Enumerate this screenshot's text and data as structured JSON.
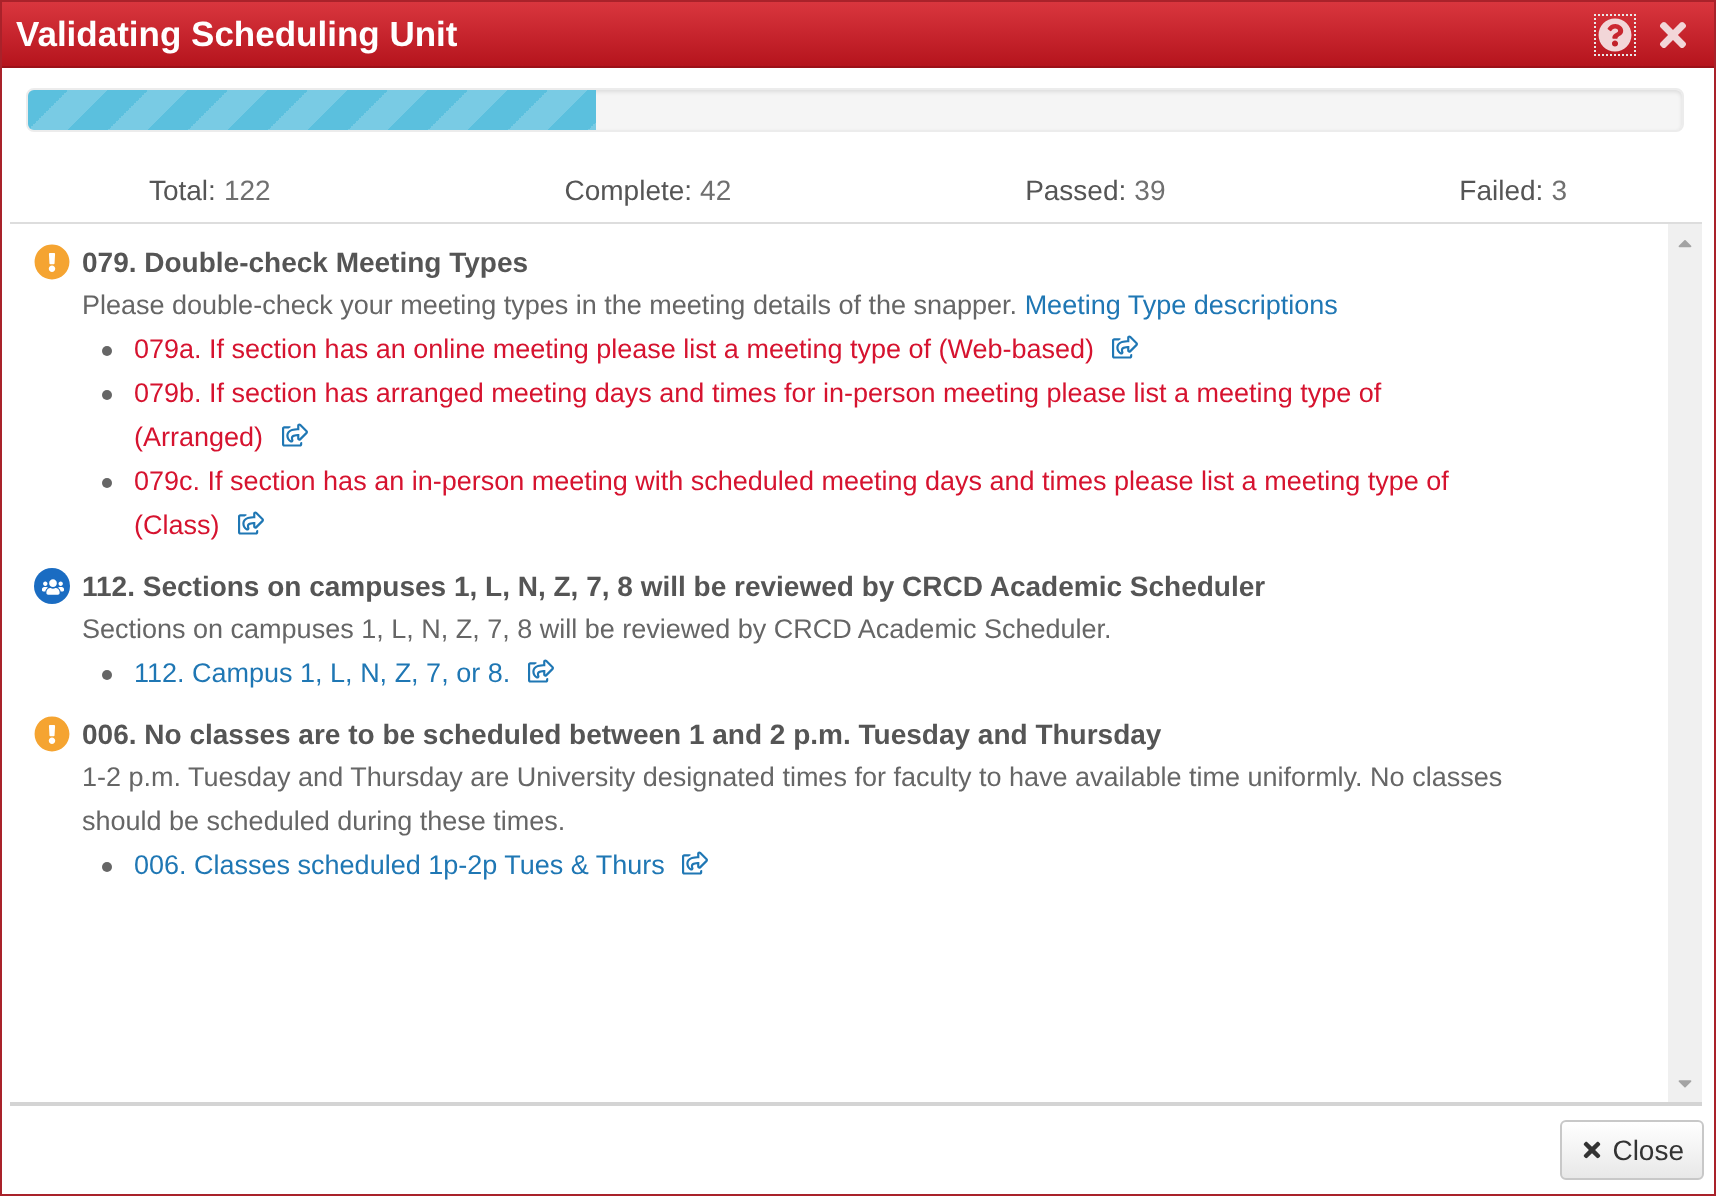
{
  "dialog": {
    "title": "Validating Scheduling Unit"
  },
  "progress": {
    "level": 0.344
  },
  "stats": [
    {
      "label": "Total:",
      "value": "122"
    },
    {
      "label": "Complete:",
      "value": "42"
    },
    {
      "label": "Passed:",
      "value": "39"
    },
    {
      "label": "Failed:",
      "value": "3"
    }
  ],
  "rules": [
    {
      "kind": "warning",
      "title": "079. Double-check Meeting Types",
      "description": "Please double-check your meeting types in the meeting details of the snapper.",
      "link": "Meeting Type descriptions",
      "items": [
        {
          "text": "079a. If section has an online meeting please list a meeting type of (Web-based)",
          "failed": true
        },
        {
          "text": "079b. If section has arranged meeting days and times for in-person meeting please list a meeting type of (Arranged)",
          "failed": true
        },
        {
          "text": "079c. If section has an in-person meeting with scheduled meeting days and times please list a meeting type of (Class)",
          "failed": true
        }
      ]
    },
    {
      "kind": "review",
      "title": "112. Sections on campuses 1, L, N, Z, 7, 8 will be reviewed by CRCD Academic Scheduler",
      "description": "Sections on campuses 1, L, N, Z, 7, 8 will be reviewed by CRCD Academic Scheduler.",
      "items": [
        {
          "text": "112. Campus 1, L, N, Z, 7, or 8.",
          "failed": false
        }
      ]
    },
    {
      "kind": "warning",
      "title": "006. No classes are to be scheduled between 1 and 2 p.m. Tuesday and Thursday",
      "description": "1-2 p.m. Tuesday and Thursday are University designated times for faculty to have available time uniformly. No classes should be scheduled during these times.",
      "items": [
        {
          "text": "006. Classes scheduled 1p-2p Tues & Thurs",
          "failed": false
        }
      ]
    }
  ],
  "footer": {
    "close_button": "Close"
  }
}
